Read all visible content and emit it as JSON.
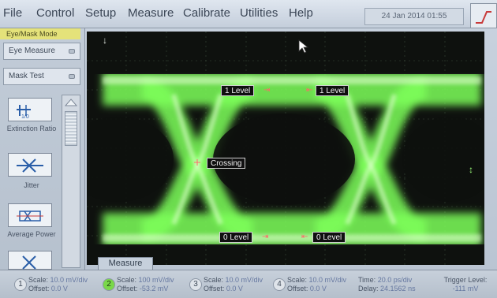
{
  "menu": {
    "file": "File",
    "control": "Control",
    "setup": "Setup",
    "measure": "Measure",
    "calibrate": "Calibrate",
    "utilities": "Utilities",
    "help": "Help"
  },
  "datetime": "24 Jan 2014  01:55",
  "left_panel": {
    "mode_tab": "Eye/Mask Mode",
    "eye_measure": "Eye Measure",
    "mask_test": "Mask Test",
    "measurements": [
      {
        "label": "Extinction Ratio",
        "icon": "extinction-ratio-icon"
      },
      {
        "label": "Jitter",
        "icon": "jitter-icon"
      },
      {
        "label": "Average Power",
        "icon": "average-power-icon"
      },
      {
        "label": "",
        "icon": "eye-measure-icon"
      }
    ]
  },
  "display": {
    "markers": {
      "one_level_left": "1 Level",
      "one_level_right": "1 Level",
      "crossing": "Crossing",
      "zero_level_left": "0 Level",
      "zero_level_right": "0 Level"
    },
    "trace_color": "#7dff5a",
    "marker_color": "#ff6a6a"
  },
  "measure_tab": "Measure",
  "status": {
    "channels": [
      {
        "num": "1",
        "scale": "10.0 mV/div",
        "offset": "0.0 V",
        "active": false
      },
      {
        "num": "2",
        "scale": "100 mV/div",
        "offset": "-53.2 mV",
        "active": true
      },
      {
        "num": "3",
        "scale": "10.0 mV/div",
        "offset": "0.0 V",
        "active": false
      },
      {
        "num": "4",
        "scale": "10.0 mV/div",
        "offset": "0.0 V",
        "active": false
      }
    ],
    "scale_label": "Scale:",
    "offset_label": "Offset:",
    "time_label": "Time:",
    "time_value": "20.0 ps/div",
    "delay_label": "Delay:",
    "delay_value": "24.1562 ns",
    "trigger_label": "Trigger Level:",
    "trigger_value": "-111 mV"
  }
}
